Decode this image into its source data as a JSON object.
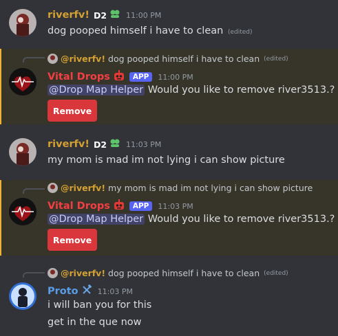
{
  "messages": [
    {
      "username": "riverfv!",
      "tag": "D2",
      "timestamp": "11:00 PM",
      "text": "dog pooped himself i have to clean",
      "edited": "(edited)"
    },
    {
      "reply": {
        "username": "@riverfv!",
        "text": "dog pooped himself i have to clean",
        "edited": "(edited)"
      },
      "username": "Vital Drops",
      "badge": "APP",
      "timestamp": "11:00 PM",
      "mention": "@Drop Map Helper",
      "text": "Would you like to remove river3513.?",
      "button": "Remove"
    },
    {
      "username": "riverfv!",
      "tag": "D2",
      "timestamp": "11:03 PM",
      "text": "my mom is mad im not lying i can show picture"
    },
    {
      "reply": {
        "username": "@riverfv!",
        "text": "my mom is mad im not lying i can show picture"
      },
      "username": "Vital Drops",
      "badge": "APP",
      "timestamp": "11:03 PM",
      "mention": "@Drop Map Helper",
      "text": "Would you like to remove river3513.?",
      "button": "Remove"
    },
    {
      "reply": {
        "username": "@riverfv!",
        "text": "dog pooped himself i have to clean",
        "edited": "(edited)"
      },
      "username": "Proto",
      "timestamp": "11:03 PM",
      "text": "i will ban you for this",
      "followup": "get in the que now"
    }
  ],
  "colors": {
    "background": "#313338",
    "highlight": "#373429",
    "river_name": "#d4a132",
    "bot_name": "#f23f43",
    "proto_name": "#5a9de6",
    "danger_button": "#da373c",
    "app_badge": "#5865f2"
  },
  "icons": [
    "clover-badge-icon",
    "robot-emoji-icon",
    "hammer-wrench-icon",
    "heartbeat-avatar-icon"
  ]
}
